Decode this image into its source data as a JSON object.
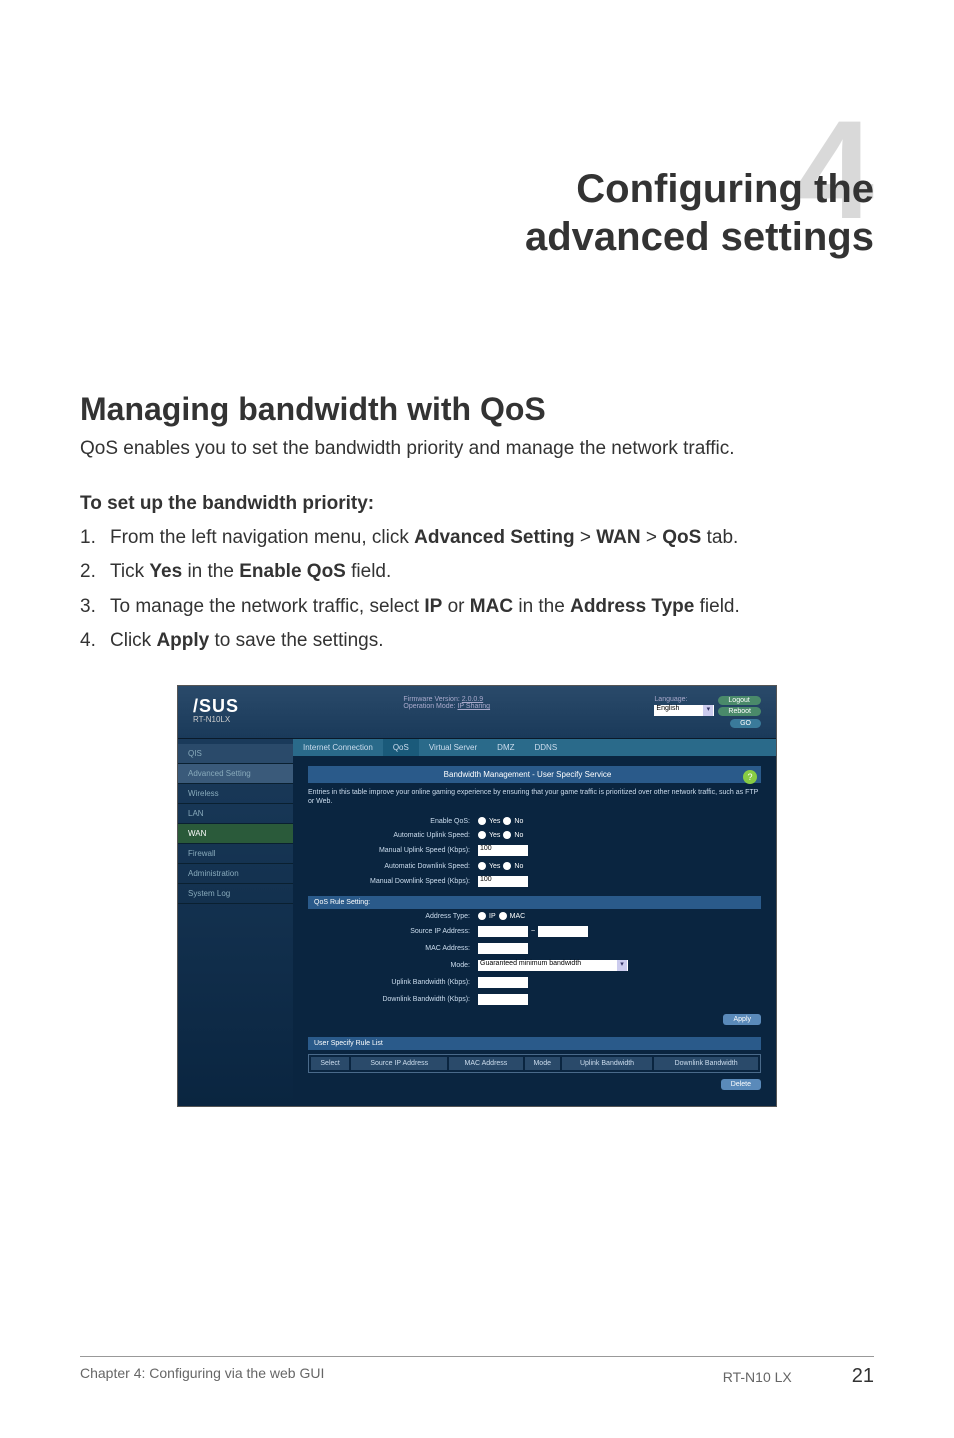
{
  "chapter": {
    "number": "4",
    "title_line1": "Configuring the",
    "title_line2": "advanced settings"
  },
  "section": {
    "title": "Managing bandwidth with QoS",
    "description": "QoS enables you to set the bandwidth priority and manage the network traffic."
  },
  "procedure": {
    "heading": "To set up the bandwidth priority:",
    "steps": {
      "s1_pre": "From the left navigation menu, click ",
      "s1_b1": "Advanced Setting",
      "s1_gt1": " > ",
      "s1_b2": "WAN",
      "s1_gt2": " > ",
      "s1_b3": "QoS",
      "s1_post": " tab.",
      "s2_pre": "Tick ",
      "s2_b1": "Yes",
      "s2_mid": " in the ",
      "s2_b2": "Enable QoS",
      "s2_post": " field.",
      "s3_pre": "To manage the network traffic, select ",
      "s3_b1": "IP",
      "s3_mid1": " or ",
      "s3_b2": "MAC",
      "s3_mid2": " in the ",
      "s3_b3": "Address Type",
      "s3_post": " field.",
      "s4_pre": "Click ",
      "s4_b1": "Apply",
      "s4_post": " to save the settings."
    }
  },
  "router": {
    "logo": "/SUS",
    "model": "RT-N10LX",
    "firmware_label": "Firmware Version:",
    "firmware_link": "2.0.0.9",
    "opmode_label": "Operation Mode:",
    "opmode_link": "IP Sharing",
    "language_label": "Language:",
    "language_value": "English",
    "logout_btn": "Logout",
    "reboot_btn": "Reboot",
    "go_btn": "GO",
    "sidebar": {
      "qos": "QIS",
      "advanced": "Advanced Setting",
      "wireless": "Wireless",
      "lan": "LAN",
      "wan": "WAN",
      "firewall": "Firewall",
      "admin": "Administration",
      "syslog": "System Log"
    },
    "tabs": {
      "internet": "Internet Connection",
      "qos": "QoS",
      "virtual": "Virtual Server",
      "dmz": "DMZ",
      "ddns": "DDNS"
    },
    "panel_title": "Bandwidth Management - User Specify Service",
    "panel_desc": "Entries in this table improve your online gaming experience by ensuring that your game traffic is prioritized over other network traffic, such as FTP or Web.",
    "help_icon": "?",
    "form": {
      "enable_qos": "Enable QoS:",
      "auto_up": "Automatic Uplink Speed:",
      "manual_up": "Manual Uplink Speed (Kbps):",
      "auto_down": "Automatic Downlink Speed:",
      "manual_down": "Manual Downlink Speed (Kbps):",
      "yes": "Yes",
      "no": "No",
      "value_100": "100"
    },
    "rule_section": "QoS Rule Setting:",
    "rule_form": {
      "addr_type": "Address Type:",
      "ip": "IP",
      "mac": "MAC",
      "source_ip": "Source IP Address:",
      "mac_addr": "MAC Address:",
      "mode": "Mode:",
      "mode_value": "Guaranteed minimum bandwidth",
      "up_bw": "Uplink Bandwidth (Kbps):",
      "down_bw": "Downlink Bandwidth (Kbps):"
    },
    "apply_label": "Apply",
    "rule_list_header": "User Specify Rule List",
    "table_headers": {
      "select": "Select",
      "source_ip": "Source IP Address",
      "mac": "MAC Address",
      "mode": "Mode",
      "up": "Uplink Bandwidth",
      "down": "Downlink Bandwidth"
    },
    "delete_btn": "Delete"
  },
  "footer": {
    "left": "Chapter 4: Configuring via the web GUI",
    "product": "RT-N10 LX",
    "page": "21"
  }
}
